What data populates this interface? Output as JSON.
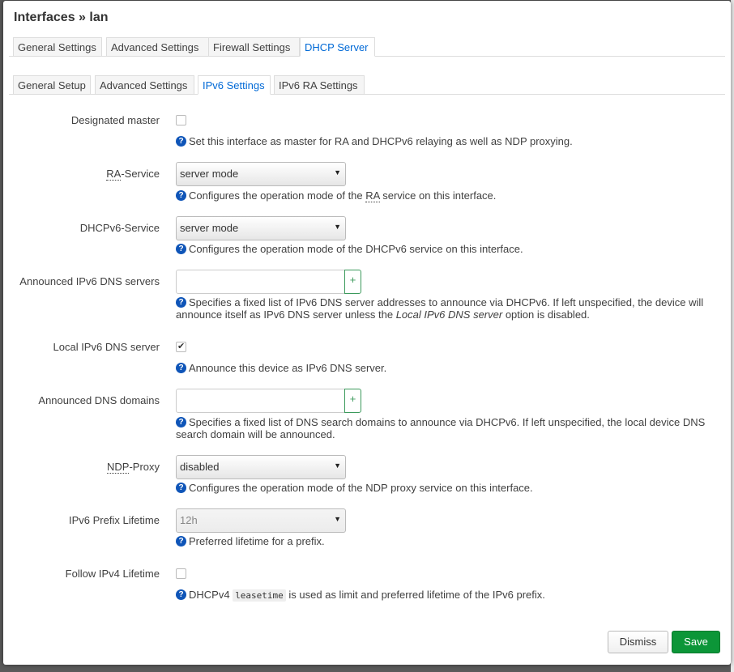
{
  "modal": {
    "title": "Interfaces » lan"
  },
  "main_tabs": [
    {
      "label": "General Settings",
      "active": false
    },
    {
      "label": "Advanced Settings",
      "active": false
    },
    {
      "label": "Firewall Settings",
      "active": false
    },
    {
      "label": "DHCP Server",
      "active": true
    }
  ],
  "sub_tabs": [
    {
      "label": "General Setup",
      "active": false
    },
    {
      "label": "Advanced Settings",
      "active": false
    },
    {
      "label": "IPv6 Settings",
      "active": true
    },
    {
      "label": "IPv6 RA Settings",
      "active": false
    }
  ],
  "fields": {
    "designated_master": {
      "label": "Designated master",
      "checked": false,
      "help": "Set this interface as master for RA and DHCPv6 relaying as well as NDP proxying."
    },
    "ra_service": {
      "label_abbr": "RA",
      "label_rest": "-Service",
      "value": "server mode",
      "help_pre": "Configures the operation mode of the ",
      "help_abbr": "RA",
      "help_post": " service on this interface."
    },
    "dhcpv6_service": {
      "label": "DHCPv6-Service",
      "value": "server mode",
      "help": "Configures the operation mode of the DHCPv6 service on this interface."
    },
    "announced_dns_servers": {
      "label": "Announced IPv6 DNS servers",
      "value": "",
      "add": "+",
      "help_pre": "Specifies a fixed list of IPv6 DNS server addresses to announce via DHCPv6. If left unspecified, the device will announce itself as IPv6 DNS server unless the ",
      "help_em": "Local IPv6 DNS server",
      "help_post": " option is disabled."
    },
    "local_dns_server": {
      "label": "Local IPv6 DNS server",
      "checked": true,
      "help": "Announce this device as IPv6 DNS server."
    },
    "announced_dns_domains": {
      "label": "Announced DNS domains",
      "value": "",
      "add": "+",
      "help": "Specifies a fixed list of DNS search domains to announce via DHCPv6. If left unspecified, the local device DNS search domain will be announced."
    },
    "ndp_proxy": {
      "label_abbr": "NDP",
      "label_rest": "-Proxy",
      "value": "disabled",
      "help": "Configures the operation mode of the NDP proxy service on this interface."
    },
    "prefix_lifetime": {
      "label": "IPv6 Prefix Lifetime",
      "value": "12h",
      "help": "Preferred lifetime for a prefix."
    },
    "follow_ipv4": {
      "label": "Follow IPv4 Lifetime",
      "checked": false,
      "help_pre": "DHCPv4 ",
      "help_code": "leasetime",
      "help_post": " is used as limit and preferred lifetime of the IPv6 prefix."
    }
  },
  "icons": {
    "help": "question-circle-icon",
    "select_caret": "caret-down-icon",
    "check": "checkmark-icon"
  },
  "glyphs": {
    "help": "?",
    "caret": "▼",
    "check": "✔"
  },
  "buttons": {
    "dismiss": "Dismiss",
    "save": "Save"
  },
  "colors": {
    "accent": "#0069d6",
    "save": "#0c9638",
    "add": "#3c9a5c",
    "help_icon": "#0f55b8"
  }
}
